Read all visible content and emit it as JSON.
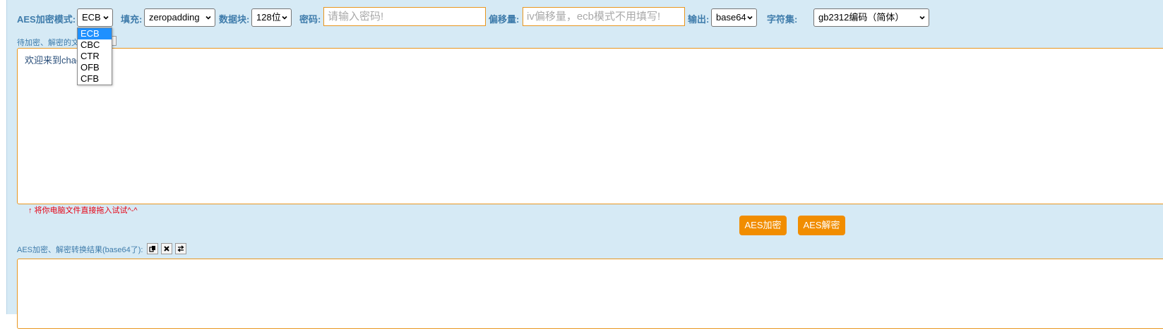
{
  "toolbar": {
    "mode_label": "AES加密模式:",
    "mode_value": "ECB",
    "padding_label": "填充:",
    "padding_value": "zeropadding",
    "block_label": "数据块:",
    "block_value": "128位",
    "password_label": "密码:",
    "password_placeholder": "请输入密码!",
    "iv_label": "偏移量:",
    "iv_placeholder": "iv偏移量，ecb模式不用填写!",
    "output_label": "输出:",
    "output_value": "base64",
    "charset_label": "字符集:",
    "charset_value": "gb2312编码（简体）"
  },
  "mode_dropdown": {
    "options": [
      "ECB",
      "CBC",
      "CTR",
      "OFB",
      "CFB"
    ],
    "selected": "ECB"
  },
  "input_section": {
    "label": "待加密、解密的文",
    "text": "欢迎来到chao",
    "tip": "↑ 将你电脑文件直接拖入试试^-^"
  },
  "actions": {
    "encrypt_label": "AES加密",
    "decrypt_label": "AES解密"
  },
  "result_section": {
    "label": "AES加密、解密转换结果(base64了):",
    "icons": [
      "copy-icon",
      "clear-icon",
      "swap-icon"
    ],
    "text": ""
  },
  "colors": {
    "panel_bg": "#d6eaf5",
    "label_blue": "#3f7cab",
    "accent_orange": "#f18d00",
    "input_border": "#e8961f",
    "tip_red": "#e60012"
  }
}
